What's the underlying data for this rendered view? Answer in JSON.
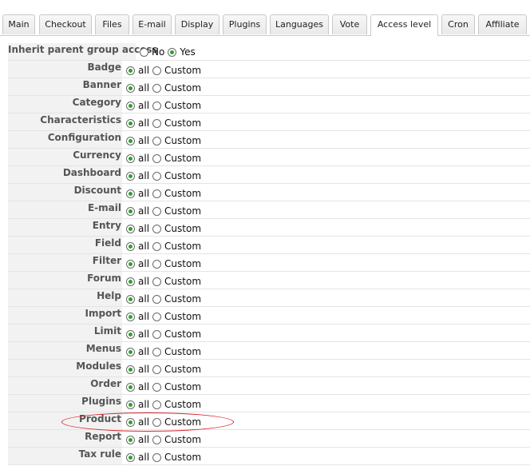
{
  "tabs": [
    {
      "label": "Main",
      "active": false
    },
    {
      "label": "Checkout",
      "active": false
    },
    {
      "label": "Files",
      "active": false
    },
    {
      "label": "E-mail",
      "active": false
    },
    {
      "label": "Display",
      "active": false
    },
    {
      "label": "Plugins",
      "active": false
    },
    {
      "label": "Languages",
      "active": false
    },
    {
      "label": "Vote",
      "active": false
    },
    {
      "label": "Access level",
      "active": true
    },
    {
      "label": "Cron",
      "active": false
    },
    {
      "label": "Affiliate",
      "active": false
    }
  ],
  "inherit": {
    "label": "Inherit parent group access",
    "no": "No",
    "yes": "Yes",
    "selected": "yes"
  },
  "options": {
    "all": "all",
    "custom": "Custom"
  },
  "permissions": [
    {
      "label": "Badge",
      "selected": "all"
    },
    {
      "label": "Banner",
      "selected": "all"
    },
    {
      "label": "Category",
      "selected": "all"
    },
    {
      "label": "Characteristics",
      "selected": "all"
    },
    {
      "label": "Configuration",
      "selected": "all"
    },
    {
      "label": "Currency",
      "selected": "all"
    },
    {
      "label": "Dashboard",
      "selected": "all"
    },
    {
      "label": "Discount",
      "selected": "all"
    },
    {
      "label": "E-mail",
      "selected": "all"
    },
    {
      "label": "Entry",
      "selected": "all"
    },
    {
      "label": "Field",
      "selected": "all"
    },
    {
      "label": "Filter",
      "selected": "all"
    },
    {
      "label": "Forum",
      "selected": "all"
    },
    {
      "label": "Help",
      "selected": "all"
    },
    {
      "label": "Import",
      "selected": "all"
    },
    {
      "label": "Limit",
      "selected": "all"
    },
    {
      "label": "Menus",
      "selected": "all"
    },
    {
      "label": "Modules",
      "selected": "all"
    },
    {
      "label": "Order",
      "selected": "all"
    },
    {
      "label": "Plugins",
      "selected": "all"
    },
    {
      "label": "Product",
      "selected": "all",
      "highlighted": true
    },
    {
      "label": "Report",
      "selected": "all"
    },
    {
      "label": "Tax rule",
      "selected": "all"
    }
  ],
  "colors": {
    "highlight": "#d6252e",
    "radio_checked": "#2da12d"
  }
}
